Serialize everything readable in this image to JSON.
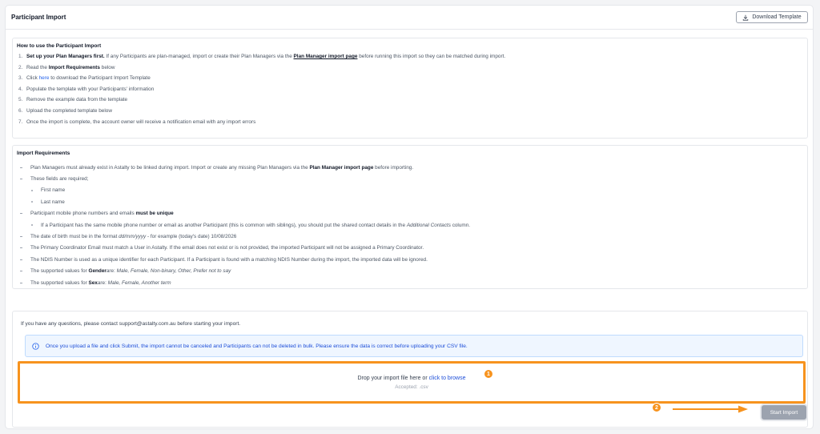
{
  "header": {
    "title": "Participant Import",
    "download_label": "Download Template"
  },
  "how_to": {
    "heading": "How to use the Participant Import",
    "steps": [
      {
        "num": "1.",
        "bold": "Set up your Plan Managers first.",
        "text_a": " If any Participants are plan-managed, import or create their Plan Managers via the ",
        "link": "Plan Manager import page",
        "text_b": " before running this import so they can be matched during import."
      },
      {
        "num": "2.",
        "text_a": "Read the ",
        "bold": "Import Requirements",
        "text_b": " below"
      },
      {
        "num": "3.",
        "text_a": "Click ",
        "link": "here",
        "text_b": " to download the Participant Import Template"
      },
      {
        "num": "4.",
        "text": "Populate the template with your Participants' information"
      },
      {
        "num": "5.",
        "text": "Remove the example data from the template"
      },
      {
        "num": "6.",
        "text": "Upload the completed template below"
      },
      {
        "num": "7.",
        "text": "Once the import is complete, the account owner will receive a notification email with any import errors"
      }
    ]
  },
  "requirements": {
    "heading": "Import Requirements",
    "r1_a": "Plan Managers must already exist in Astalty to be linked during import. Import or create any missing Plan Managers via the ",
    "r1_bold": "Plan Manager import page",
    "r1_b": " before importing.",
    "r2": "These fields are required;",
    "r2_sub1": "First name",
    "r2_sub2": "Last name",
    "r3_a": "Participant mobile phone numbers and emails ",
    "r3_bold": "must be unique",
    "r3_sub_a": "If a Participant has the same mobile phone number or email as another Participant (this is common with siblings), you should put the shared contact details in the ",
    "r3_sub_italic": "Additional Contacts",
    "r3_sub_b": " column.",
    "r4_a": "The date of birth must be in the format ",
    "r4_italic": "dd/mm/yyyy",
    "r4_b": " - for example (today's date) 10/08/2026",
    "r5": "The Primary Coordinator Email must match a User in Astalty. If the email does not exist or is not provided, the imported Participant will not be assigned a Primary Coordinator.",
    "r6": "The NDIS Number is used as a unique identifier for each Participant. If a Participant is found with a matching NDIS Number during the import, the imported data will be ignored.",
    "r7_a": "The supported values for ",
    "r7_bold": "Gender",
    "r7_b": " are: ",
    "r7_italic": "Male, Female, Non-binary, Other, Prefer not to say",
    "r8_a": "The supported values for ",
    "r8_bold": "Sex",
    "r8_b": " are: ",
    "r8_italic": "Male, Female, Another term"
  },
  "upload": {
    "contact": "If you have any questions, please contact support@astalty.com.au before starting your import.",
    "info": "Once you upload a file and click Submit, the import cannot be canceled and Participants can not be deleted in bulk. Please ensure the data is correct before uploading your CSV file.",
    "drop_text": "Drop your import file here or ",
    "drop_link": "click to browse",
    "accepted": "Accepted: .csv",
    "start_label": "Start Import"
  },
  "annotations": {
    "badge1": "1",
    "badge2": "2"
  },
  "colors": {
    "accent_orange": "#f7931e",
    "link_blue": "#2563eb",
    "info_bg": "#eff6ff",
    "disabled_button": "#9ca3af"
  },
  "icons": {
    "download": "download-icon",
    "info": "info-circle-icon"
  }
}
